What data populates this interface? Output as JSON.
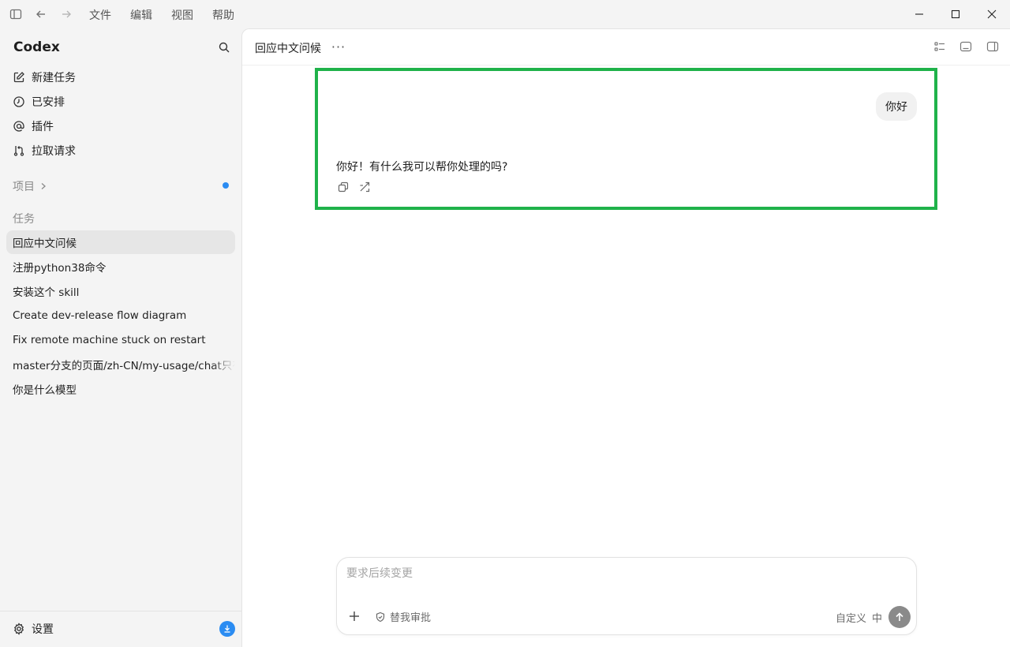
{
  "menu": {
    "file": "文件",
    "edit": "编辑",
    "view": "视图",
    "help": "帮助"
  },
  "sidebar": {
    "brand": "Codex",
    "nav": [
      {
        "label": "新建任务",
        "icon": "edit-icon"
      },
      {
        "label": "已安排",
        "icon": "clock-icon"
      },
      {
        "label": "插件",
        "icon": "at-icon"
      },
      {
        "label": "拉取请求",
        "icon": "pull-request-icon"
      }
    ],
    "projects_label": "项目",
    "tasks_label": "任务",
    "tasks": [
      "回应中文问候",
      "注册python38命令",
      "安装这个 skill",
      "Create dev-release flow diagram",
      "Fix remote machine stuck on restart",
      "master分支的页面/zh-CN/my-usage/chat只有",
      "你是什么模型"
    ],
    "active_task_index": 0,
    "settings_label": "设置"
  },
  "main": {
    "title": "回应中文问候",
    "more_label": "···",
    "conversation": {
      "user_message": "你好",
      "assistant_message": "你好！有什么我可以帮你处理的吗?"
    },
    "composer": {
      "placeholder": "要求后续变更",
      "approval_label": "替我审批",
      "custom_label": "自定义",
      "lang_label": "中"
    }
  },
  "colors": {
    "accent": "#2b8cf2",
    "highlight": "#1fb24a",
    "active_row": "#e6e6e6",
    "send_button": "#8a8a8a"
  }
}
